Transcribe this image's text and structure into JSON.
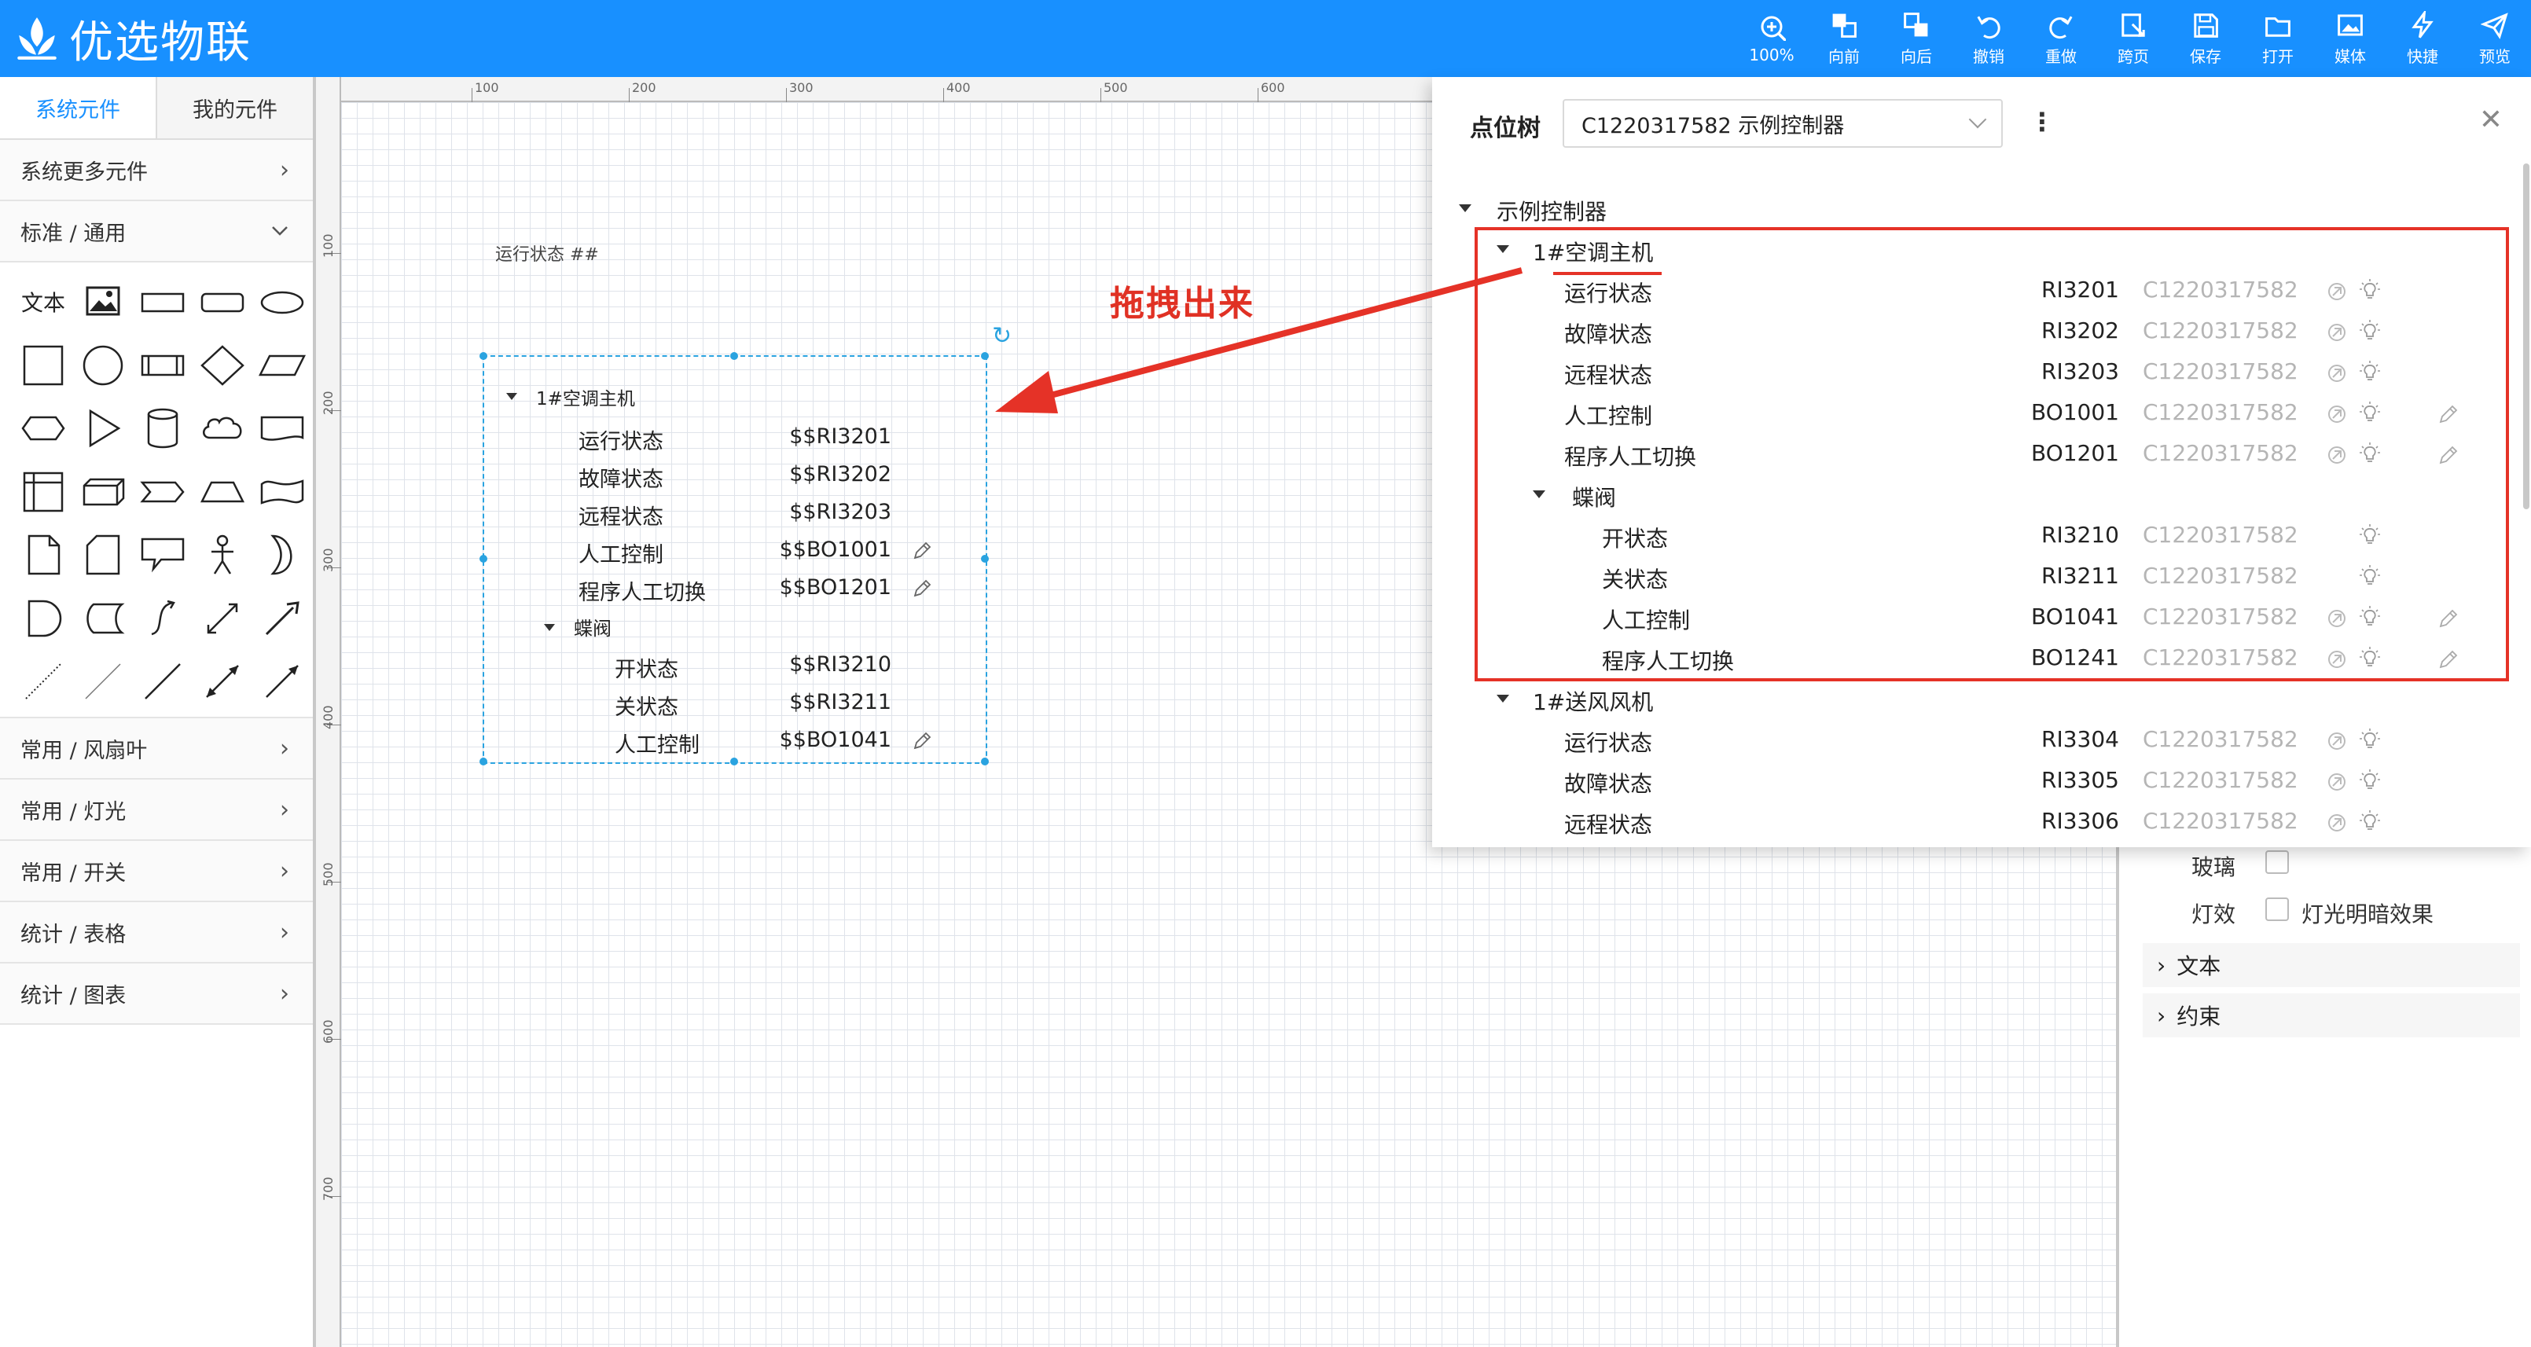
{
  "app": {
    "title": "优选物联"
  },
  "toolbar": [
    {
      "label": "100%",
      "icon": "zoom-icon"
    },
    {
      "label": "向前",
      "icon": "bring-forward-icon"
    },
    {
      "label": "向后",
      "icon": "send-backward-icon"
    },
    {
      "label": "撤销",
      "icon": "undo-icon"
    },
    {
      "label": "重做",
      "icon": "redo-icon"
    },
    {
      "label": "跨页",
      "icon": "cross-page-icon"
    },
    {
      "label": "保存",
      "icon": "save-icon"
    },
    {
      "label": "打开",
      "icon": "open-icon"
    },
    {
      "label": "媒体",
      "icon": "media-icon"
    },
    {
      "label": "快捷",
      "icon": "shortcut-icon"
    },
    {
      "label": "预览",
      "icon": "preview-icon"
    }
  ],
  "left_panel": {
    "tabs": [
      "系统元件",
      "我的元件"
    ],
    "more_components": "系统更多元件",
    "category_open": "标准 / 通用",
    "text_shape_label": "文本",
    "categories": [
      "常用 / 风扇叶",
      "常用 / 灯光",
      "常用 / 开关",
      "统计 / 表格",
      "统计 / 图表"
    ]
  },
  "canvas": {
    "ruler_top": [
      "100",
      "200",
      "300",
      "400",
      "500",
      "600"
    ],
    "ruler_left": [
      "100",
      "200",
      "300",
      "400",
      "500",
      "600",
      "700"
    ],
    "label": "运行状态 ##",
    "widget": {
      "group": "1#空调主机",
      "rows": [
        {
          "name": "运行状态",
          "value": "$$RI3201",
          "editable": false
        },
        {
          "name": "故障状态",
          "value": "$$RI3202",
          "editable": false
        },
        {
          "name": "远程状态",
          "value": "$$RI3203",
          "editable": false
        },
        {
          "name": "人工控制",
          "value": "$$BO1001",
          "editable": true
        },
        {
          "name": "程序人工切换",
          "value": "$$BO1201",
          "editable": true
        }
      ],
      "subgroup": "蝶阀",
      "sub_rows": [
        {
          "name": "开状态",
          "value": "$$RI3210",
          "editable": false
        },
        {
          "name": "关状态",
          "value": "$$RI3211",
          "editable": false
        },
        {
          "name": "人工控制",
          "value": "$$BO1041",
          "editable": true
        }
      ]
    }
  },
  "annotation": {
    "text": "拖拽出来",
    "color": "#e03124"
  },
  "point_tree": {
    "title": "点位树",
    "selected_controller": "C1220317582 示例控制器",
    "root": "示例控制器",
    "groups": [
      {
        "name": "1#空调主机",
        "points": [
          {
            "name": "运行状态",
            "code": "RI3201",
            "controller": "C1220317582",
            "edit": false
          },
          {
            "name": "故障状态",
            "code": "RI3202",
            "controller": "C1220317582",
            "edit": false
          },
          {
            "name": "远程状态",
            "code": "RI3203",
            "controller": "C1220317582",
            "edit": false
          },
          {
            "name": "人工控制",
            "code": "BO1001",
            "controller": "C1220317582",
            "edit": true
          },
          {
            "name": "程序人工切换",
            "code": "BO1201",
            "controller": "C1220317582",
            "edit": true
          }
        ],
        "subgroup": {
          "name": "蝶阀",
          "points": [
            {
              "name": "开状态",
              "code": "RI3210",
              "controller": "C1220317582",
              "edit": false,
              "link": false
            },
            {
              "name": "关状态",
              "code": "RI3211",
              "controller": "C1220317582",
              "edit": false,
              "link": false
            },
            {
              "name": "人工控制",
              "code": "BO1041",
              "controller": "C1220317582",
              "edit": true,
              "link": true
            },
            {
              "name": "程序人工切换",
              "code": "BO1241",
              "controller": "C1220317582",
              "edit": true,
              "link": true
            }
          ]
        }
      },
      {
        "name": "1#送风风机",
        "points": [
          {
            "name": "运行状态",
            "code": "RI3304",
            "controller": "C1220317582"
          },
          {
            "name": "故障状态",
            "code": "RI3305",
            "controller": "C1220317582"
          },
          {
            "name": "远程状态",
            "code": "RI3306",
            "controller": "C1220317582"
          }
        ]
      }
    ]
  },
  "properties": {
    "glass_label": "玻璃",
    "light_label": "灯效",
    "light_option": "灯光明暗效果",
    "sections": [
      "文本",
      "约束"
    ]
  },
  "colors": {
    "primary": "#1890ff",
    "highlight": "#e53227",
    "selection": "#2aa3e0"
  }
}
